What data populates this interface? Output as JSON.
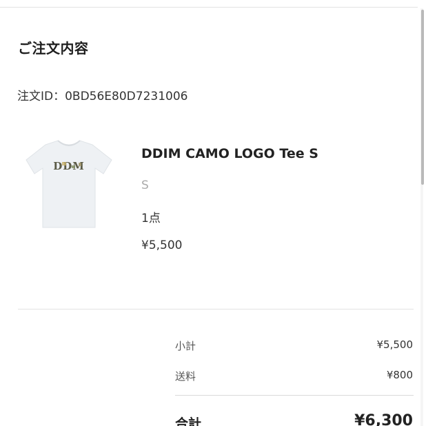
{
  "header": {
    "title": "ご注文内容"
  },
  "order": {
    "id_text": "注文ID：0BD56E80D7231006"
  },
  "product": {
    "image_icon": "tshirt-image",
    "logo_text": "DDM",
    "name": "DDIM CAMO LOGO Tee S",
    "variant": "S",
    "quantity": "1点",
    "price": "¥5,500"
  },
  "summary": {
    "subtotal_label": "小計",
    "subtotal_value": "¥5,500",
    "shipping_label": "送料",
    "shipping_value": "¥800",
    "total_label": "合計",
    "total_value": "¥6,300"
  },
  "colors": {
    "text": "#222222",
    "muted": "#aaaaaa",
    "divider": "#e3e3e3"
  }
}
